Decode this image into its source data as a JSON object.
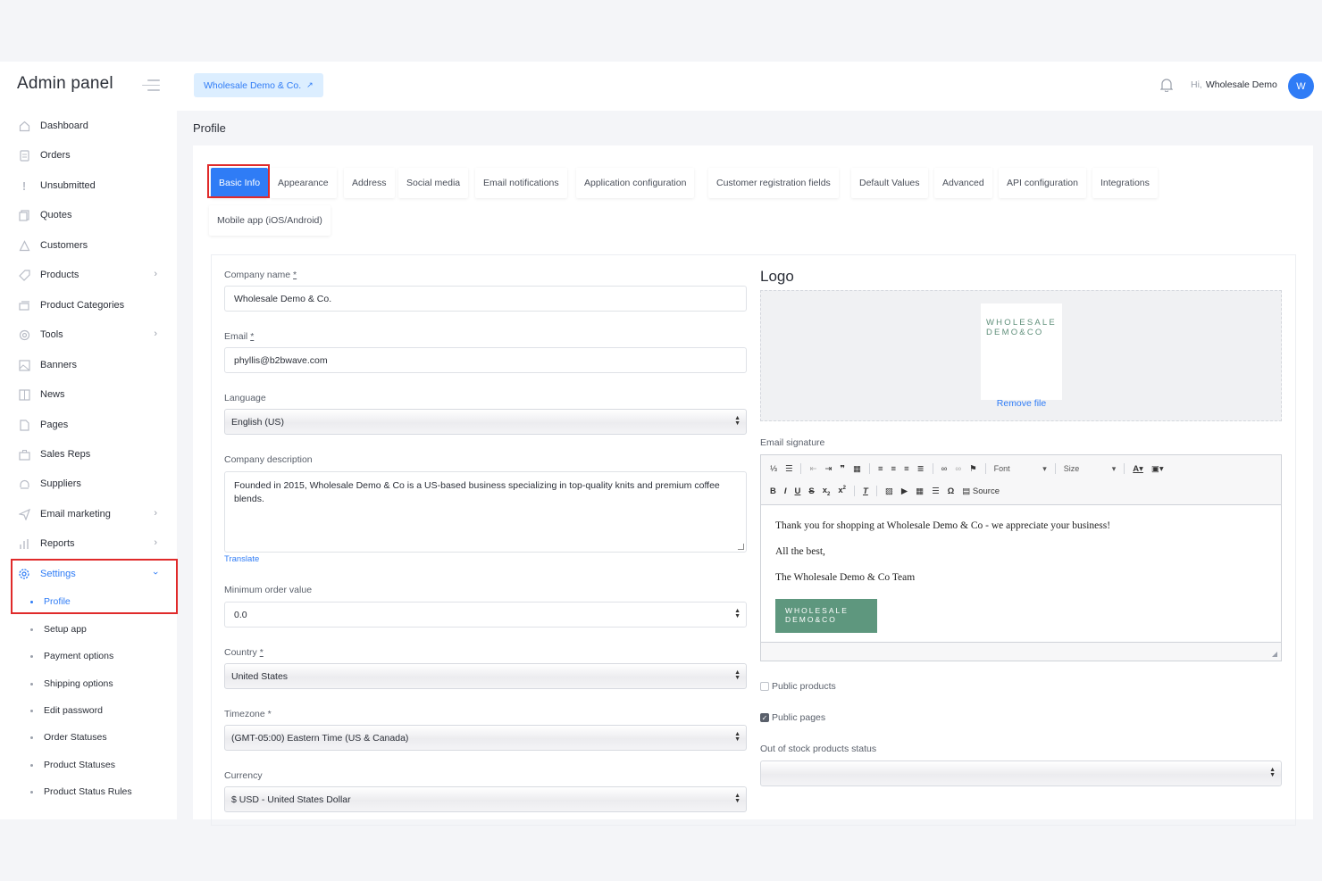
{
  "sidebar": {
    "brand": "Admin panel",
    "items": [
      {
        "label": "Dashboard",
        "icon": "home-icon"
      },
      {
        "label": "Orders",
        "icon": "document-icon"
      },
      {
        "label": "Unsubmitted",
        "icon": "exclamation-icon"
      },
      {
        "label": "Quotes",
        "icon": "files-icon"
      },
      {
        "label": "Customers",
        "icon": "users-icon"
      },
      {
        "label": "Products",
        "icon": "tag-icon"
      },
      {
        "label": "Product Categories",
        "icon": "cards-icon"
      },
      {
        "label": "Tools",
        "icon": "tools-icon"
      },
      {
        "label": "Banners",
        "icon": "image-icon"
      },
      {
        "label": "News",
        "icon": "news-icon"
      },
      {
        "label": "Pages",
        "icon": "page-icon"
      },
      {
        "label": "Sales Reps",
        "icon": "briefcase-icon"
      },
      {
        "label": "Suppliers",
        "icon": "headset-icon"
      },
      {
        "label": "Email marketing",
        "icon": "send-icon"
      },
      {
        "label": "Reports",
        "icon": "bar-chart-icon"
      },
      {
        "label": "Settings",
        "icon": "gear-icon"
      }
    ],
    "settings_sub": [
      {
        "label": "Profile"
      },
      {
        "label": "Setup app"
      },
      {
        "label": "Payment options"
      },
      {
        "label": "Shipping options"
      },
      {
        "label": "Edit password"
      },
      {
        "label": "Order Statuses"
      },
      {
        "label": "Product Statuses"
      },
      {
        "label": "Product Status Rules"
      }
    ]
  },
  "header": {
    "store_button": "Wholesale Demo & Co.",
    "greeting_prefix": "Hi,",
    "user_name": "Wholesale Demo",
    "avatar_initial": "W"
  },
  "page": {
    "title": "Profile",
    "tabs": [
      "Basic Info",
      "Appearance",
      "Address",
      "Social media",
      "Email notifications",
      "Application configuration",
      "Customer registration fields",
      "Default Values",
      "Advanced",
      "API configuration",
      "Integrations",
      "Mobile app (iOS/Android)"
    ]
  },
  "form": {
    "company_name_label": "Company name",
    "company_name": "Wholesale Demo & Co.",
    "email_label": "Email",
    "email": "phyllis@b2bwave.com",
    "language_label": "Language",
    "language": "English (US)",
    "description_label": "Company description",
    "description": "Founded in 2015, Wholesale Demo & Co is a US-based business specializing in top-quality knits and premium coffee blends.",
    "translate_link": "Translate",
    "min_order_label": "Minimum order value",
    "min_order": "0.0",
    "country_label": "Country",
    "country": "United States",
    "timezone_label": "Timezone",
    "timezone": "(GMT-05:00) Eastern Time (US & Canada)",
    "currency_label": "Currency",
    "currency": "$ USD - United States Dollar",
    "required_mark": "*",
    "logo_title": "Logo",
    "logo_text_1": "WHOLESALE",
    "logo_text_2": "DEMO&CO",
    "remove_file": "Remove file",
    "email_signature_label": "Email signature",
    "editor_font": "Font",
    "editor_size": "Size",
    "editor_source": "Source",
    "signature_lines": [
      "Thank you for shopping at Wholesale Demo & Co - we appreciate your business!",
      "All the best,",
      "The Wholesale Demo & Co Team"
    ],
    "public_products_label": "Public products",
    "public_products": false,
    "public_pages_label": "Public pages",
    "public_pages": true,
    "out_of_stock_label": "Out of stock products status",
    "out_of_stock": ""
  },
  "colors": {
    "accent": "#2f7cf6",
    "highlight": "#e02a2a",
    "logo_green": "#5e977e"
  }
}
